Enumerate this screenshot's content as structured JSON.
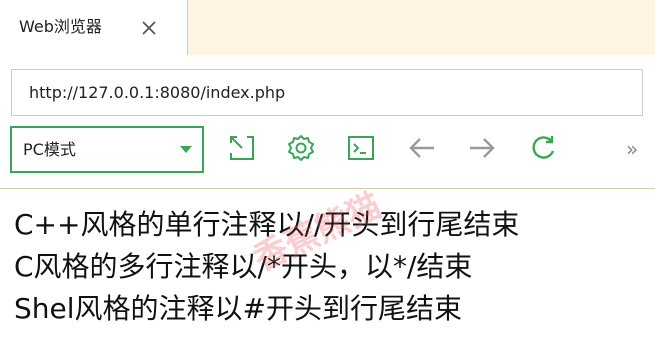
{
  "tab": {
    "title": "Web浏览器"
  },
  "address_bar": {
    "url": "http://127.0.0.1:8080/index.php"
  },
  "toolbar": {
    "mode": "PC模式",
    "icons": [
      "restore-window-icon",
      "settings-icon",
      "terminal-icon",
      "back-arrow-icon",
      "forward-arrow-icon",
      "refresh-icon",
      "more-chevron-icon"
    ],
    "more": "»"
  },
  "content": {
    "lines": [
      "C++风格的单行注释以//开头到行尾结束",
      "C风格的多行注释以/*开头，以*/结束",
      "Shel风格的注释以#开头到行尾结束"
    ]
  },
  "watermark": "香蕉熊猫",
  "colors": {
    "accent": "#3aa655",
    "chrome_background": "#fdf5e2",
    "nav_disabled": "#9a9a9a"
  }
}
